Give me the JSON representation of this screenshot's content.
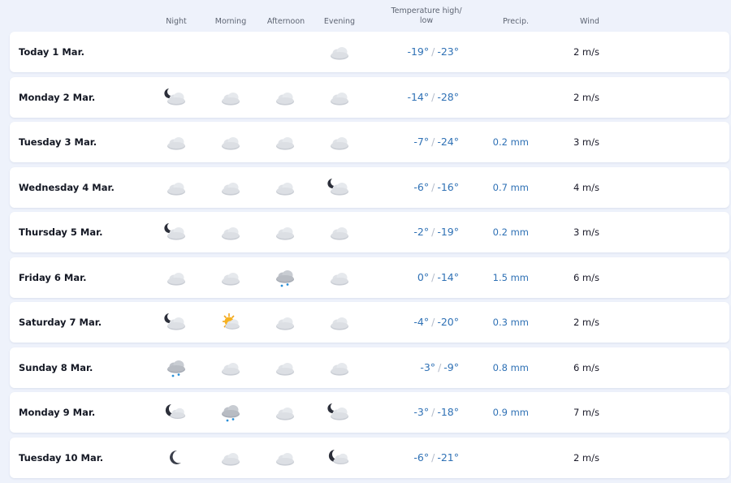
{
  "headers": {
    "night": "Night",
    "morning": "Morning",
    "afternoon": "Afternoon",
    "evening": "Evening",
    "temp_line1": "Temperature high/",
    "temp_line2": "low",
    "precip": "Precip.",
    "wind": "Wind"
  },
  "temp_separator": "/",
  "colors": {
    "temperature": "#2f71b5",
    "precipitation": "#2f71b5",
    "background": "#eef2fb",
    "card": "#ffffff"
  },
  "days": [
    {
      "day": "Today 1 Mar.",
      "night": null,
      "morning": null,
      "afternoon": null,
      "evening": "cloudy-icon",
      "high": "-19°",
      "low": "-23°",
      "precip": "",
      "wind": "2 m/s"
    },
    {
      "day": "Monday 2 Mar.",
      "night": "cloudy-night-icon",
      "morning": "cloudy-icon",
      "afternoon": "cloudy-icon",
      "evening": "cloudy-icon",
      "high": "-14°",
      "low": "-28°",
      "precip": "",
      "wind": "2 m/s"
    },
    {
      "day": "Tuesday 3 Mar.",
      "night": "cloudy-icon",
      "morning": "cloudy-icon",
      "afternoon": "cloudy-icon",
      "evening": "cloudy-icon",
      "high": "-7°",
      "low": "-24°",
      "precip": "0.2 mm",
      "wind": "3 m/s"
    },
    {
      "day": "Wednesday 4 Mar.",
      "night": "cloudy-icon",
      "morning": "cloudy-icon",
      "afternoon": "cloudy-icon",
      "evening": "cloudy-night-icon",
      "high": "-6°",
      "low": "-16°",
      "precip": "0.7 mm",
      "wind": "4 m/s"
    },
    {
      "day": "Thursday 5 Mar.",
      "night": "cloudy-night-icon",
      "morning": "cloudy-icon",
      "afternoon": "cloudy-icon",
      "evening": "cloudy-icon",
      "high": "-2°",
      "low": "-19°",
      "precip": "0.2 mm",
      "wind": "3 m/s"
    },
    {
      "day": "Friday 6 Mar.",
      "night": "cloudy-icon",
      "morning": "cloudy-icon",
      "afternoon": "light-rain-icon",
      "evening": "cloudy-icon",
      "high": "0°",
      "low": "-14°",
      "precip": "1.5 mm",
      "wind": "6 m/s"
    },
    {
      "day": "Saturday 7 Mar.",
      "night": "cloudy-night-icon",
      "morning": "partly-sunny-icon",
      "afternoon": "cloudy-icon",
      "evening": "cloudy-icon",
      "high": "-4°",
      "low": "-20°",
      "precip": "0.3 mm",
      "wind": "2 m/s"
    },
    {
      "day": "Sunday 8 Mar.",
      "night": "light-rain-icon",
      "morning": "cloudy-icon",
      "afternoon": "cloudy-icon",
      "evening": "cloudy-icon",
      "high": "-3°",
      "low": "-9°",
      "precip": "0.8 mm",
      "wind": "6 m/s"
    },
    {
      "day": "Monday 9 Mar.",
      "night": "partly-cloudy-night-icon",
      "morning": "light-rain-icon",
      "afternoon": "cloudy-icon",
      "evening": "cloudy-night-icon",
      "high": "-3°",
      "low": "-18°",
      "precip": "0.9 mm",
      "wind": "7 m/s"
    },
    {
      "day": "Tuesday 10 Mar.",
      "night": "clear-night-icon",
      "morning": "cloudy-icon",
      "afternoon": "cloudy-icon",
      "evening": "partly-cloudy-night-icon",
      "high": "-6°",
      "low": "-21°",
      "precip": "",
      "wind": "2 m/s"
    }
  ]
}
